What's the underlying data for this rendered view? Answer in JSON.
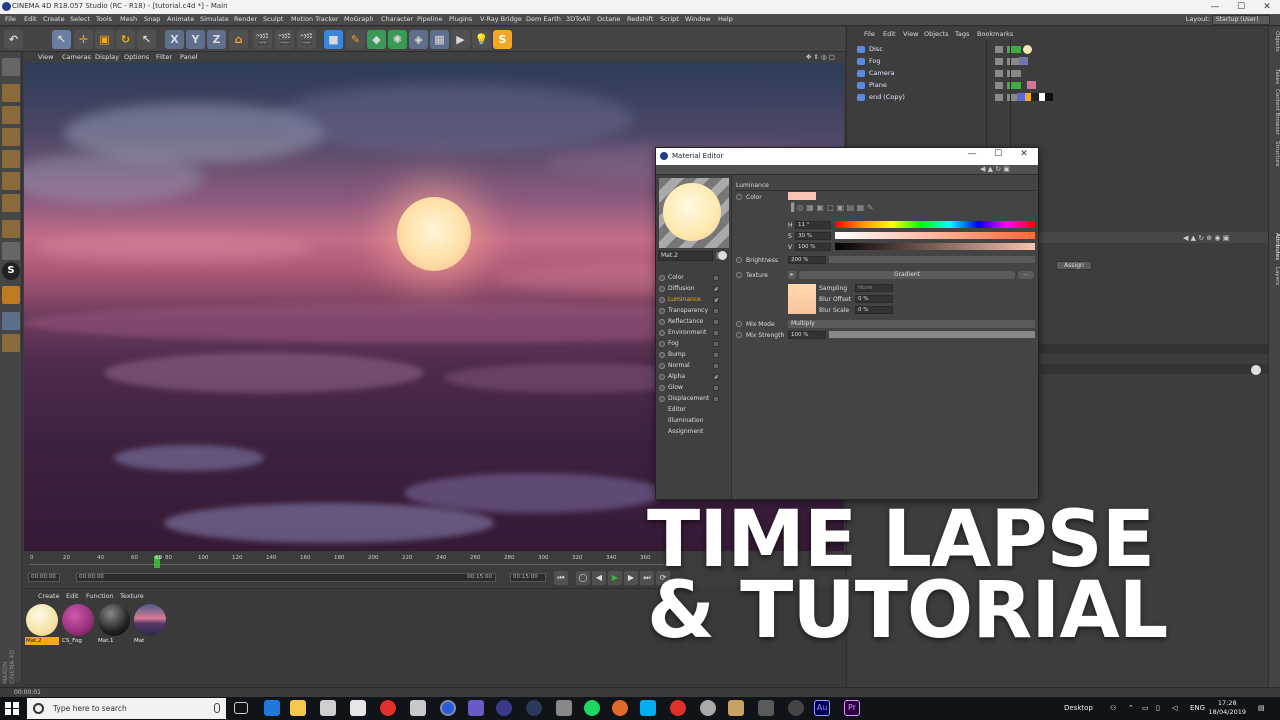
{
  "window": {
    "title": "CINEMA 4D R18.057 Studio (RC - R18) - [tutorial.c4d *] - Main",
    "minimize": "—",
    "maximize": "☐",
    "close": "✕"
  },
  "menubar": {
    "items": [
      "File",
      "Edit",
      "Create",
      "Select",
      "Tools",
      "Mesh",
      "Snap",
      "Animate",
      "Simulate",
      "Render",
      "Sculpt",
      "Motion Tracker",
      "MoGraph",
      "Character",
      "Pipeline",
      "Plugins",
      "V-Ray Bridge",
      "Dem Earth",
      "3DToAll",
      "Octane",
      "Redshift",
      "Script",
      "Window",
      "Help"
    ],
    "layout_label": "Layout:",
    "layout_value": "Startup (User)"
  },
  "toolbar": {
    "axis_x": "X",
    "axis_y": "Y",
    "axis_z": "Z"
  },
  "viewport": {
    "menu": [
      "View",
      "Cameras",
      "Display",
      "Options",
      "Filter",
      "Panel"
    ]
  },
  "timeline": {
    "ticks": [
      "0",
      "20",
      "40",
      "60",
      "69",
      "80",
      "100",
      "120",
      "140",
      "160",
      "180",
      "200",
      "220",
      "240",
      "260",
      "280",
      "300",
      "320",
      "340",
      "360"
    ],
    "current_frame": "69",
    "field_start": "00:00:00",
    "field_min": "00:00:00",
    "field_max": "00:15:00",
    "field_end": "00:15:00"
  },
  "material_manager": {
    "menu": [
      "Create",
      "Edit",
      "Function",
      "Texture"
    ],
    "materials": [
      {
        "name": "Mat.2",
        "selected": true
      },
      {
        "name": "CS_Fog",
        "selected": false
      },
      {
        "name": "Mat.1",
        "selected": false
      },
      {
        "name": "Mat",
        "selected": false
      }
    ],
    "brand": "MAXON CINEMA 4D"
  },
  "object_manager": {
    "menu": [
      "File",
      "Edit",
      "View",
      "Objects",
      "Tags",
      "Bookmarks"
    ],
    "objects": [
      "Disc",
      "Fog",
      "Camera",
      "Plane",
      "end (Copy)"
    ]
  },
  "attribute_manager": {
    "assign_label": "Assign"
  },
  "right_tabs": [
    "Objects",
    "Takes",
    "Content Browser",
    "Structure",
    "Attributes",
    "Layers"
  ],
  "material_editor": {
    "title": "Material Editor",
    "material_name": "Mat.2",
    "channels": [
      {
        "name": "Color",
        "checked": false
      },
      {
        "name": "Diffusion",
        "checked": true
      },
      {
        "name": "Luminance",
        "checked": true,
        "active": true
      },
      {
        "name": "Transparency",
        "checked": false
      },
      {
        "name": "Reflectance",
        "checked": false
      },
      {
        "name": "Environment",
        "checked": false
      },
      {
        "name": "Fog",
        "checked": false
      },
      {
        "name": "Bump",
        "checked": false
      },
      {
        "name": "Normal",
        "checked": false
      },
      {
        "name": "Alpha",
        "checked": true
      },
      {
        "name": "Glow",
        "checked": false
      },
      {
        "name": "Displacement",
        "checked": false
      },
      {
        "name": "Editor",
        "checked": null
      },
      {
        "name": "Illumination",
        "checked": null
      },
      {
        "name": "Assignment",
        "checked": null
      }
    ],
    "section": "Luminance",
    "color_label": "Color",
    "color_swatch": "#f9c3b2",
    "h_label": "H",
    "h_value": "11 °",
    "s_label": "S",
    "s_value": "30 %",
    "v_label": "V",
    "v_value": "100 %",
    "brightness_label": "Brightness",
    "brightness_value": "200 %",
    "texture_label": "Texture",
    "texture_value": "Gradient",
    "texture_more": "...",
    "sampling_label": "Sampling",
    "sampling_value": "None",
    "blur_offset_label": "Blur Offset",
    "blur_offset_value": "0 %",
    "blur_scale_label": "Blur Scale",
    "blur_scale_value": "0 %",
    "mix_mode_label": "Mix Mode",
    "mix_mode_value": "Multiply",
    "mix_strength_label": "Mix Strength",
    "mix_strength_value": "100 %"
  },
  "overlay": {
    "line1": "TIME LAPSE",
    "line2": "& TUTORIAL"
  },
  "statusbar": {
    "time": "00:00:01"
  },
  "taskbar": {
    "search_placeholder": "Type here to search",
    "desktop_label": "Desktop",
    "language": "ENG",
    "time": "17:28",
    "date": "18/04/2019"
  },
  "colors": {
    "accent_orange": "#f5a623",
    "active_channel": "#f5a623",
    "timeline_cursor": "#3fae3f"
  }
}
